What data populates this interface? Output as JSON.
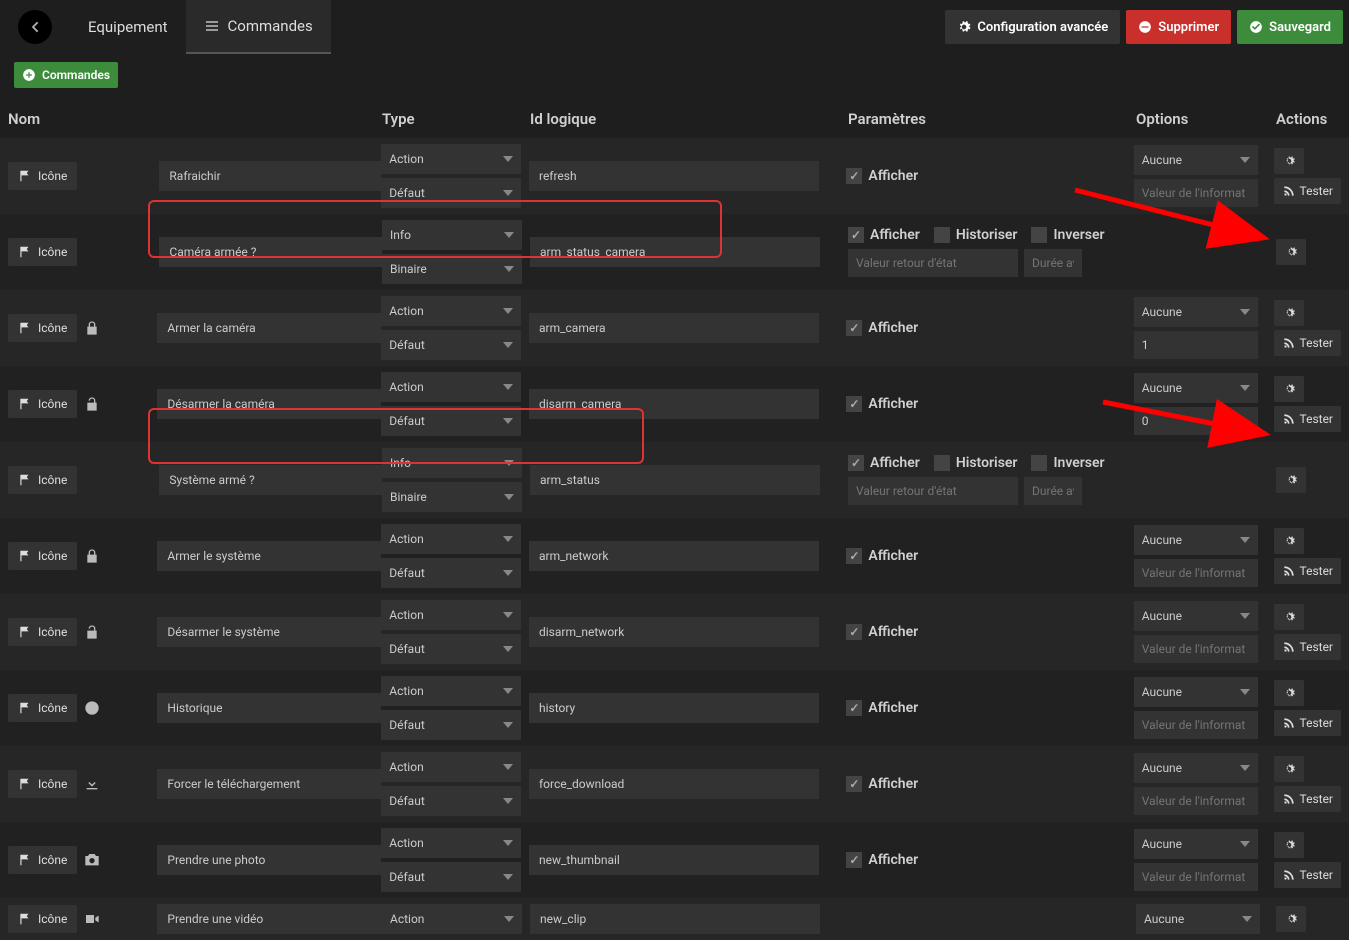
{
  "top": {
    "tab_equipement": "Equipement",
    "tab_commandes": "Commandes",
    "btn_config": "Configuration avancée",
    "btn_supprimer": "Supprimer",
    "btn_sauvegarder": "Sauvegard"
  },
  "toolbar": {
    "btn_cmd": "Commandes"
  },
  "head": {
    "nom": "Nom",
    "type": "Type",
    "id": "Id logique",
    "param": "Paramètres",
    "opt": "Options",
    "act": "Actions"
  },
  "labels": {
    "icone": "Icône",
    "afficher": "Afficher",
    "historiser": "Historiser",
    "inverser": "Inverser",
    "tester": "Tester",
    "aucune": "Aucune",
    "ph_retour": "Valeur retour d'état",
    "ph_duree": "Durée av",
    "ph_valinfo": "Valeur de l'informat"
  },
  "rows": [
    {
      "icon": "",
      "name": "Rafraichir",
      "t1": "Action",
      "t2": "Défaut",
      "id": "refresh",
      "param": "afficher",
      "opt": "aucune+valinfo",
      "act": "both"
    },
    {
      "icon": "",
      "name": "Caméra armée ?",
      "t1": "Info",
      "t2": "Binaire",
      "id": "arm_status_camera",
      "param": "info",
      "opt": "none",
      "act": "gear",
      "hl": true
    },
    {
      "icon": "lock",
      "name": "Armer la caméra",
      "t1": "Action",
      "t2": "Défaut",
      "id": "arm_camera",
      "param": "afficher",
      "opt": "aucune+val",
      "optval": "1",
      "act": "both"
    },
    {
      "icon": "unlock",
      "name": "Désarmer la caméra",
      "t1": "Action",
      "t2": "Défaut",
      "id": "disarm_camera",
      "param": "afficher",
      "opt": "aucune+val",
      "optval": "0",
      "act": "both"
    },
    {
      "icon": "",
      "name": "Système armé ?",
      "t1": "Info",
      "t2": "Binaire",
      "id": "arm_status",
      "param": "info",
      "opt": "none",
      "act": "gear",
      "hl": true
    },
    {
      "icon": "lock",
      "name": "Armer le système",
      "t1": "Action",
      "t2": "Défaut",
      "id": "arm_network",
      "param": "afficher",
      "opt": "aucune+valinfo",
      "act": "both"
    },
    {
      "icon": "unlock",
      "name": "Désarmer le système",
      "t1": "Action",
      "t2": "Défaut",
      "id": "disarm_network",
      "param": "afficher",
      "opt": "aucune+valinfo",
      "act": "both"
    },
    {
      "icon": "clock",
      "name": "Historique",
      "t1": "Action",
      "t2": "Défaut",
      "id": "history",
      "param": "afficher",
      "opt": "aucune+valinfo",
      "act": "both"
    },
    {
      "icon": "download",
      "name": "Forcer le téléchargement",
      "t1": "Action",
      "t2": "Défaut",
      "id": "force_download",
      "param": "afficher",
      "opt": "aucune+valinfo",
      "act": "both"
    },
    {
      "icon": "camera",
      "name": "Prendre une photo",
      "t1": "Action",
      "t2": "Défaut",
      "id": "new_thumbnail",
      "param": "afficher",
      "opt": "aucune+valinfo",
      "act": "both"
    },
    {
      "icon": "video",
      "name": "Prendre une vidéo",
      "t1": "Action",
      "t2": "",
      "id": "new_clip",
      "param": "",
      "opt": "aucune",
      "act": "gear"
    }
  ]
}
